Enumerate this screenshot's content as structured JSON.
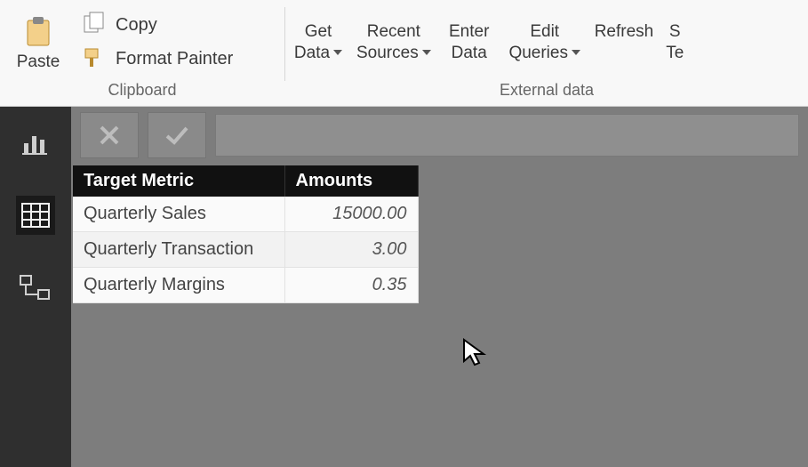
{
  "ribbon": {
    "clipboard": {
      "paste": "Paste",
      "copy": "Copy",
      "format_painter": "Format Painter",
      "group_label": "Clipboard"
    },
    "external": {
      "get_data_l1": "Get",
      "get_data_l2": "Data",
      "recent_l1": "Recent",
      "recent_l2": "Sources",
      "enter_l1": "Enter",
      "enter_l2": "Data",
      "edit_l1": "Edit",
      "edit_l2": "Queries",
      "refresh": "Refresh",
      "group_label": "External data"
    },
    "cut_right1": "S",
    "cut_right2": "Te"
  },
  "table": {
    "headers": {
      "metric": "Target Metric",
      "amount": "Amounts"
    },
    "rows": [
      {
        "metric": "Quarterly Sales",
        "amount": "15000.00"
      },
      {
        "metric": "Quarterly Transaction",
        "amount": "3.00"
      },
      {
        "metric": "Quarterly Margins",
        "amount": "0.35"
      }
    ]
  },
  "chart_data": {
    "type": "table",
    "columns": [
      "Target Metric",
      "Amounts"
    ],
    "rows": [
      [
        "Quarterly Sales",
        15000.0
      ],
      [
        "Quarterly Transaction",
        3.0
      ],
      [
        "Quarterly Margins",
        0.35
      ]
    ]
  }
}
